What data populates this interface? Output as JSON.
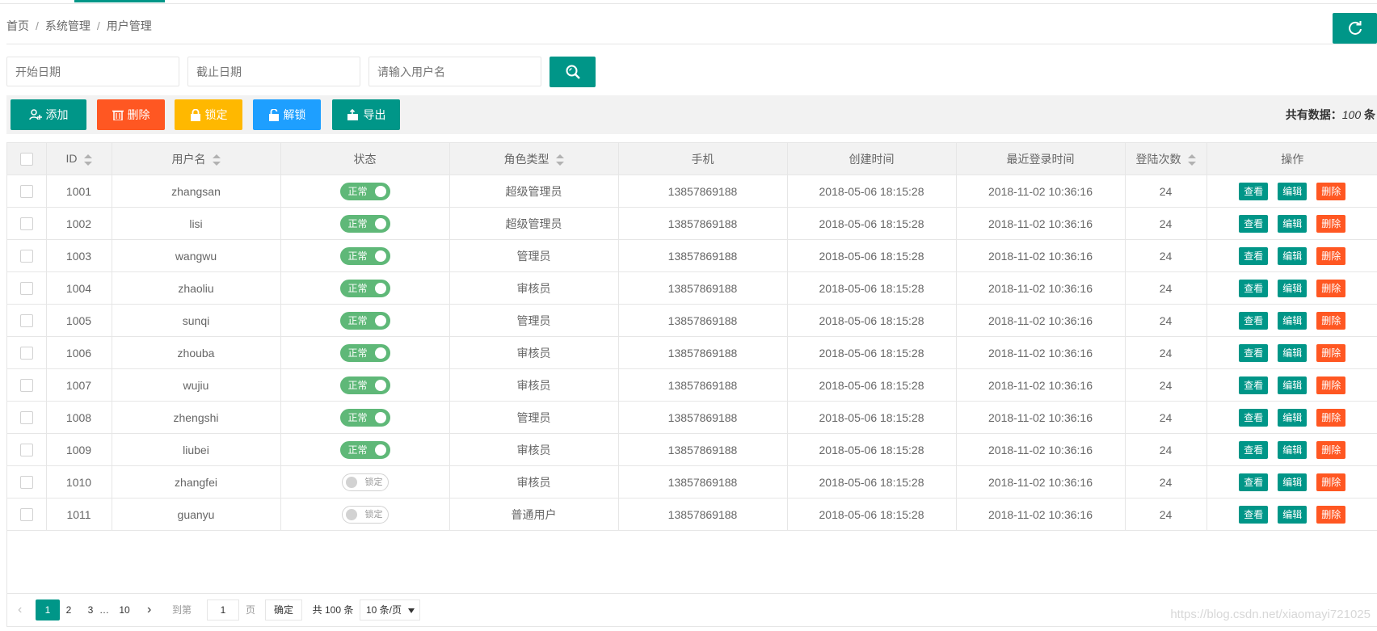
{
  "breadcrumb": {
    "items": [
      "首页",
      "系统管理",
      "用户管理"
    ],
    "separator": "/"
  },
  "filters": {
    "start_date_placeholder": "开始日期",
    "end_date_placeholder": "截止日期",
    "username_placeholder": "请输入用户名"
  },
  "toolbar": {
    "add": "添加",
    "delete": "删除",
    "lock": "锁定",
    "unlock": "解锁",
    "export": "导出",
    "total_label": "共有数据：",
    "total_value": "100",
    "total_unit": "条"
  },
  "colors": {
    "primary": "#009688",
    "danger": "#ff5722",
    "warn": "#ffb800",
    "info": "#1e9fff",
    "switch_on": "#5fb878"
  },
  "table": {
    "headers": {
      "id": "ID",
      "username": "用户名",
      "status": "状态",
      "role": "角色类型",
      "phone": "手机",
      "created": "创建时间",
      "last_login": "最近登录时间",
      "login_count": "登陆次数",
      "actions": "操作"
    },
    "action_labels": {
      "view": "查看",
      "edit": "编辑",
      "delete": "删除"
    },
    "status_labels": {
      "on": "正常",
      "off": "锁定"
    },
    "rows": [
      {
        "id": "1001",
        "username": "zhangsan",
        "active": true,
        "role": "超级管理员",
        "phone": "13857869188",
        "created": "2018-05-06 18:15:28",
        "last_login": "2018-11-02 10:36:16",
        "login_count": "24"
      },
      {
        "id": "1002",
        "username": "lisi",
        "active": true,
        "role": "超级管理员",
        "phone": "13857869188",
        "created": "2018-05-06 18:15:28",
        "last_login": "2018-11-02 10:36:16",
        "login_count": "24"
      },
      {
        "id": "1003",
        "username": "wangwu",
        "active": true,
        "role": "管理员",
        "phone": "13857869188",
        "created": "2018-05-06 18:15:28",
        "last_login": "2018-11-02 10:36:16",
        "login_count": "24"
      },
      {
        "id": "1004",
        "username": "zhaoliu",
        "active": true,
        "role": "审核员",
        "phone": "13857869188",
        "created": "2018-05-06 18:15:28",
        "last_login": "2018-11-02 10:36:16",
        "login_count": "24"
      },
      {
        "id": "1005",
        "username": "sunqi",
        "active": true,
        "role": "管理员",
        "phone": "13857869188",
        "created": "2018-05-06 18:15:28",
        "last_login": "2018-11-02 10:36:16",
        "login_count": "24"
      },
      {
        "id": "1006",
        "username": "zhouba",
        "active": true,
        "role": "审核员",
        "phone": "13857869188",
        "created": "2018-05-06 18:15:28",
        "last_login": "2018-11-02 10:36:16",
        "login_count": "24"
      },
      {
        "id": "1007",
        "username": "wujiu",
        "active": true,
        "role": "审核员",
        "phone": "13857869188",
        "created": "2018-05-06 18:15:28",
        "last_login": "2018-11-02 10:36:16",
        "login_count": "24"
      },
      {
        "id": "1008",
        "username": "zhengshi",
        "active": true,
        "role": "管理员",
        "phone": "13857869188",
        "created": "2018-05-06 18:15:28",
        "last_login": "2018-11-02 10:36:16",
        "login_count": "24"
      },
      {
        "id": "1009",
        "username": "liubei",
        "active": true,
        "role": "审核员",
        "phone": "13857869188",
        "created": "2018-05-06 18:15:28",
        "last_login": "2018-11-02 10:36:16",
        "login_count": "24"
      },
      {
        "id": "1010",
        "username": "zhangfei",
        "active": false,
        "role": "审核员",
        "phone": "13857869188",
        "created": "2018-05-06 18:15:28",
        "last_login": "2018-11-02 10:36:16",
        "login_count": "24"
      },
      {
        "id": "1011",
        "username": "guanyu",
        "active": false,
        "role": "普通用户",
        "phone": "13857869188",
        "created": "2018-05-06 18:15:28",
        "last_login": "2018-11-02 10:36:16",
        "login_count": "24"
      }
    ]
  },
  "pagination": {
    "pages": [
      "1",
      "2",
      "3"
    ],
    "ellipsis": "…",
    "last_page": "10",
    "current": "1",
    "goto_label": "到第",
    "goto_value": "1",
    "page_label": "页",
    "confirm": "确定",
    "total_text": "共 100 条",
    "page_size": "10 条/页"
  },
  "watermark": "https://blog.csdn.net/xiaomayi721025"
}
